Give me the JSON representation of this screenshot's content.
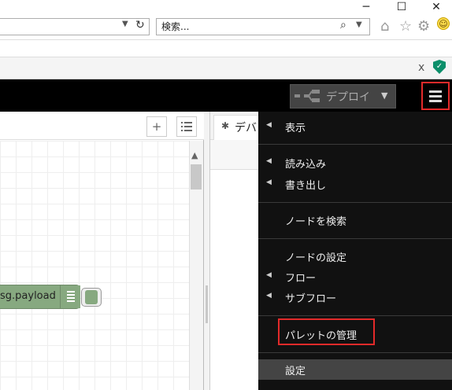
{
  "browser": {
    "window_controls": [
      "─",
      "☐",
      "✕"
    ],
    "search_placeholder": "検索...",
    "ext_close": "x",
    "toolbar_icons": [
      "home-icon",
      "star-icon",
      "gear-icon",
      "smiley-icon"
    ]
  },
  "header": {
    "deploy_label": "デプロイ"
  },
  "workspace": {
    "add_button": "+",
    "node_label": "sg.payload"
  },
  "sidebar": {
    "tab_label": "デバ"
  },
  "menu": {
    "items": [
      {
        "label": "表示",
        "has_submenu": true
      },
      {
        "label": "読み込み",
        "has_submenu": true
      },
      {
        "label": "書き出し",
        "has_submenu": true
      },
      {
        "label": "ノードを検索",
        "has_submenu": false
      },
      {
        "label": "ノードの設定",
        "has_submenu": false
      },
      {
        "label": "フロー",
        "has_submenu": true
      },
      {
        "label": "サブフロー",
        "has_submenu": true
      },
      {
        "label": "パレットの管理",
        "has_submenu": false
      },
      {
        "label": "設定",
        "has_submenu": false
      }
    ]
  },
  "colors": {
    "highlight": "#e32a2a",
    "node": "#87a980",
    "menu_bg": "#111111"
  }
}
